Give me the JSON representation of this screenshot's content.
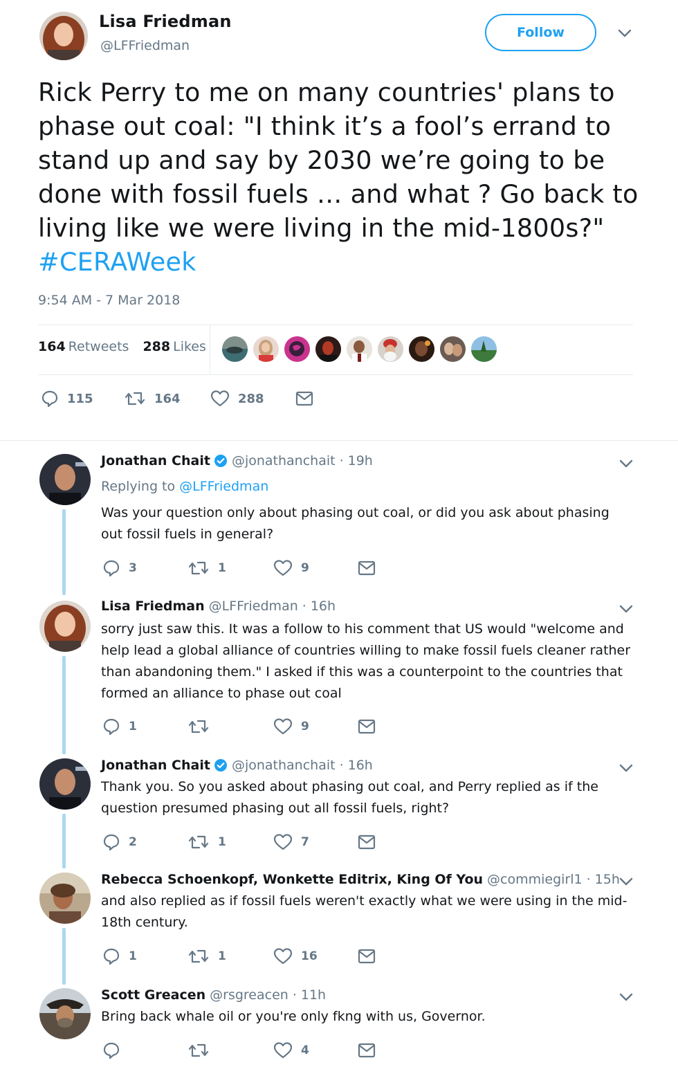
{
  "main_tweet": {
    "author_name": "Lisa Friedman",
    "author_handle": "@LFFriedman",
    "follow_label": "Follow",
    "text": "Rick Perry to me on many countries' plans to phase out coal: \"I think it’s a fool’s errand to stand up and say by 2030 we’re going to be done with fossil fuels … and what ? Go back to living like we were living in the mid-1800s?\" ",
    "hashtag": "#CERAWeek",
    "timestamp": "9:54 AM - 7 Mar 2018",
    "retweets_count": "164",
    "retweets_label": "Retweets",
    "likes_count": "288",
    "likes_label": "Likes",
    "reply_count": "115",
    "retweet_count_action": "164",
    "like_count_action": "288"
  },
  "replies": [
    {
      "name": "Jonathan Chait",
      "verified": true,
      "handle": "@jonathanchait",
      "time": "19h",
      "replying_prefix": "Replying to ",
      "replying_to": "@LFFriedman",
      "text": "Was your question only about phasing out coal, or did you ask about phasing out fossil fuels in general?",
      "replies": "3",
      "retweets": "1",
      "likes": "9"
    },
    {
      "name": "Lisa Friedman",
      "verified": false,
      "handle": "@LFFriedman",
      "time": "16h",
      "text": "sorry just saw this. It was a follow to his comment that US would \"welcome and help lead a global alliance of countries willing to make fossil fuels cleaner rather than abandoning them.\" I asked if this was a counterpoint to the countries that formed an alliance to phase out coal",
      "replies": "1",
      "retweets": "",
      "likes": "9"
    },
    {
      "name": "Jonathan Chait",
      "verified": true,
      "handle": "@jonathanchait",
      "time": "16h",
      "text": "Thank you. So you asked about phasing out coal, and Perry replied as if the question presumed phasing out all fossil fuels, right?",
      "replies": "2",
      "retweets": "1",
      "likes": "7"
    },
    {
      "name": "Rebecca Schoenkopf, Wonkette Editrix, King Of You",
      "verified": false,
      "handle": "@commiegirl1",
      "time": "15h",
      "text": "and also replied as if fossil fuels weren't exactly what we were using in the mid-18th century.",
      "replies": "1",
      "retweets": "1",
      "likes": "16"
    },
    {
      "name": "Scott Greacen",
      "verified": false,
      "handle": "@rsgreacen",
      "time": "11h",
      "text": "Bring back whale oil or you're only fkng with us, Governor.",
      "replies": "",
      "retweets": "",
      "likes": "4"
    }
  ],
  "separator_dot": "·",
  "colors": {
    "accent": "#1da1f2",
    "muted": "#657786",
    "text": "#14171a",
    "thread_line": "#a8d8f3",
    "border": "#e6ecf0"
  },
  "icons": {
    "reply": "reply-icon",
    "retweet": "retweet-icon",
    "like": "heart-icon",
    "message": "envelope-icon",
    "more": "chevron-down-icon",
    "verified": "verified-badge-icon"
  }
}
